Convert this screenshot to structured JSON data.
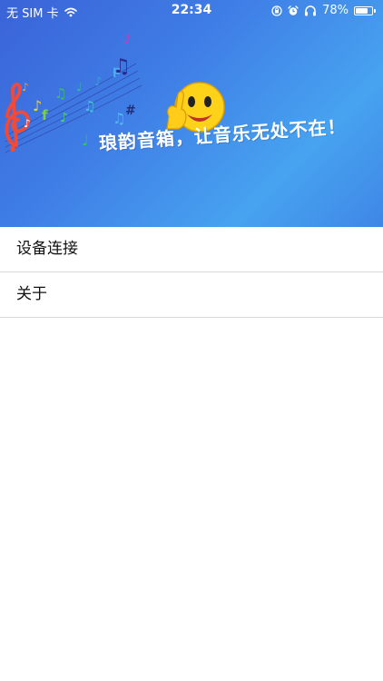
{
  "status_bar": {
    "carrier": "无 SIM 卡",
    "time": "22:34",
    "battery": "78%",
    "battery_level": 0.78,
    "icons": [
      "wifi-icon",
      "orientation-lock-icon",
      "alarm-icon",
      "headphones-icon",
      "battery-icon"
    ]
  },
  "banner": {
    "slogan": "琅韵音箱，让音乐无处不在！",
    "art": [
      "treble-clef-icon",
      "music-notes-icon",
      "smiley-thumbs-up-icon"
    ]
  },
  "menu": {
    "items": [
      {
        "label": "设备连接"
      },
      {
        "label": "关于"
      }
    ]
  },
  "colors": {
    "banner_start": "#3a63d8",
    "banner_end": "#47a3f0",
    "divider": "#d9d9d9"
  }
}
